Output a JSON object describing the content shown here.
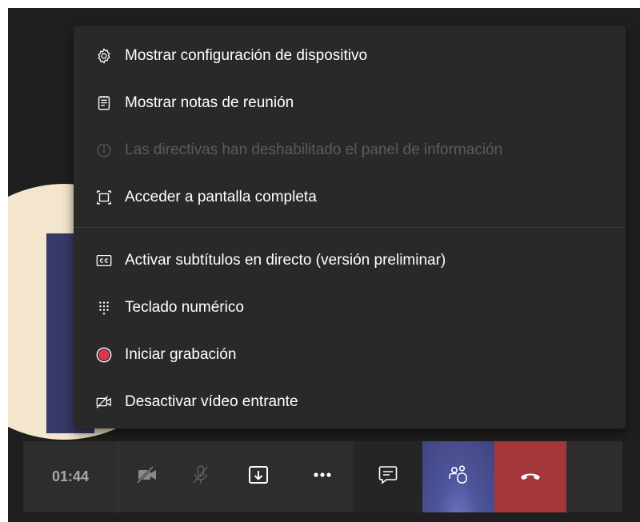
{
  "menu": {
    "items": [
      {
        "label": "Mostrar configuración de dispositivo",
        "icon": "gear-icon",
        "enabled": true
      },
      {
        "label": "Mostrar notas de reunión",
        "icon": "notes-icon",
        "enabled": true
      },
      {
        "label": "Las directivas han deshabilitado el panel de información",
        "icon": "info-icon",
        "enabled": false
      },
      {
        "label": "Acceder a pantalla completa",
        "icon": "fullscreen-icon",
        "enabled": true
      },
      {
        "label": "Activar subtítulos en directo (versión preliminar)",
        "icon": "closed-captions-icon",
        "enabled": true
      },
      {
        "label": "Teclado numérico",
        "icon": "dialpad-icon",
        "enabled": true
      },
      {
        "label": "Iniciar grabación",
        "icon": "record-icon",
        "enabled": true
      },
      {
        "label": "Desactivar vídeo entrante",
        "icon": "video-off-icon",
        "enabled": true
      }
    ]
  },
  "toolbar": {
    "timer": "01:44",
    "buttons": [
      {
        "name": "camera-toggle",
        "icon": "camera-off-icon"
      },
      {
        "name": "mic-toggle",
        "icon": "mic-off-icon"
      },
      {
        "name": "share-screen",
        "icon": "share-tray-icon"
      },
      {
        "name": "more-actions",
        "icon": "ellipsis-icon"
      },
      {
        "name": "chat",
        "icon": "chat-icon"
      },
      {
        "name": "participants",
        "icon": "people-icon"
      },
      {
        "name": "hang-up",
        "icon": "phone-hangup-icon"
      }
    ]
  },
  "colors": {
    "menu_background": "#292929",
    "stage_background": "#1f1f1f",
    "disabled_text": "#5b5b5b",
    "record_red": "#e0344e",
    "hangup_red": "#a4373a",
    "participants_active": "#4e559a"
  }
}
